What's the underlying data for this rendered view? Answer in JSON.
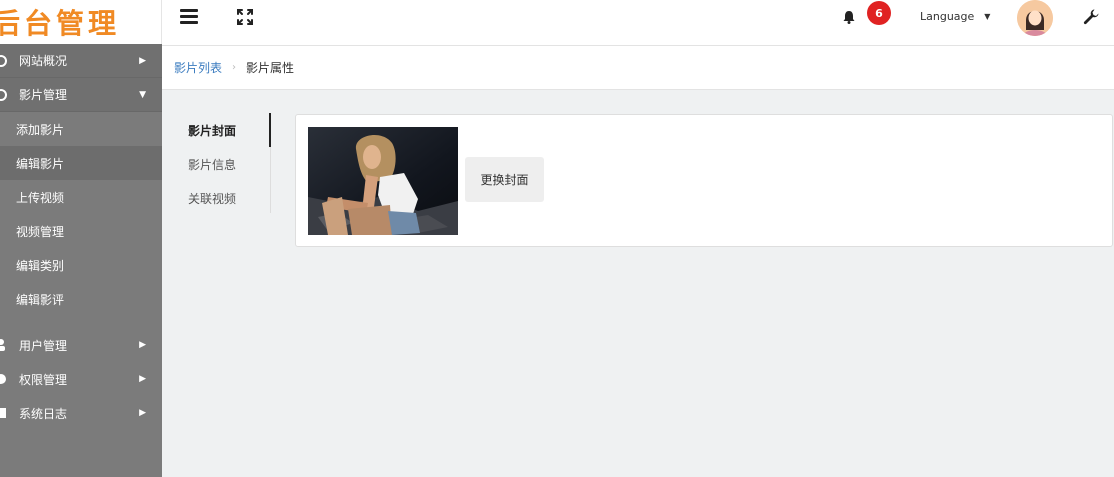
{
  "logo": {
    "text": "后台管理",
    "color": "#f08a24"
  },
  "sidebar": {
    "items": [
      {
        "label": "网站概况",
        "icon": "dashboard-icon",
        "state": "collapsed"
      },
      {
        "label": "影片管理",
        "icon": "film-icon",
        "state": "expanded",
        "children": [
          {
            "label": "添加影片"
          },
          {
            "label": "编辑影片",
            "active": true
          },
          {
            "label": "上传视频"
          },
          {
            "label": "视频管理"
          },
          {
            "label": "编辑类别"
          },
          {
            "label": "编辑影评"
          }
        ]
      },
      {
        "label": "用户管理",
        "icon": "user-icon",
        "state": "collapsed"
      },
      {
        "label": "权限管理",
        "icon": "lock-icon",
        "state": "collapsed"
      },
      {
        "label": "系统日志",
        "icon": "log-icon",
        "state": "collapsed"
      }
    ]
  },
  "topbar": {
    "notification_count": "6",
    "language_label": "Language"
  },
  "breadcrumb": {
    "parent": "影片列表",
    "current": "影片属性"
  },
  "tabs": [
    {
      "label": "影片封面",
      "active": true
    },
    {
      "label": "影片信息"
    },
    {
      "label": "关联视频"
    }
  ],
  "panel": {
    "replace_button": "更换封面"
  },
  "colors": {
    "sidebar_bg": "#7b7b7b",
    "accent_link": "#3a7bbf",
    "badge": "#e02222"
  }
}
